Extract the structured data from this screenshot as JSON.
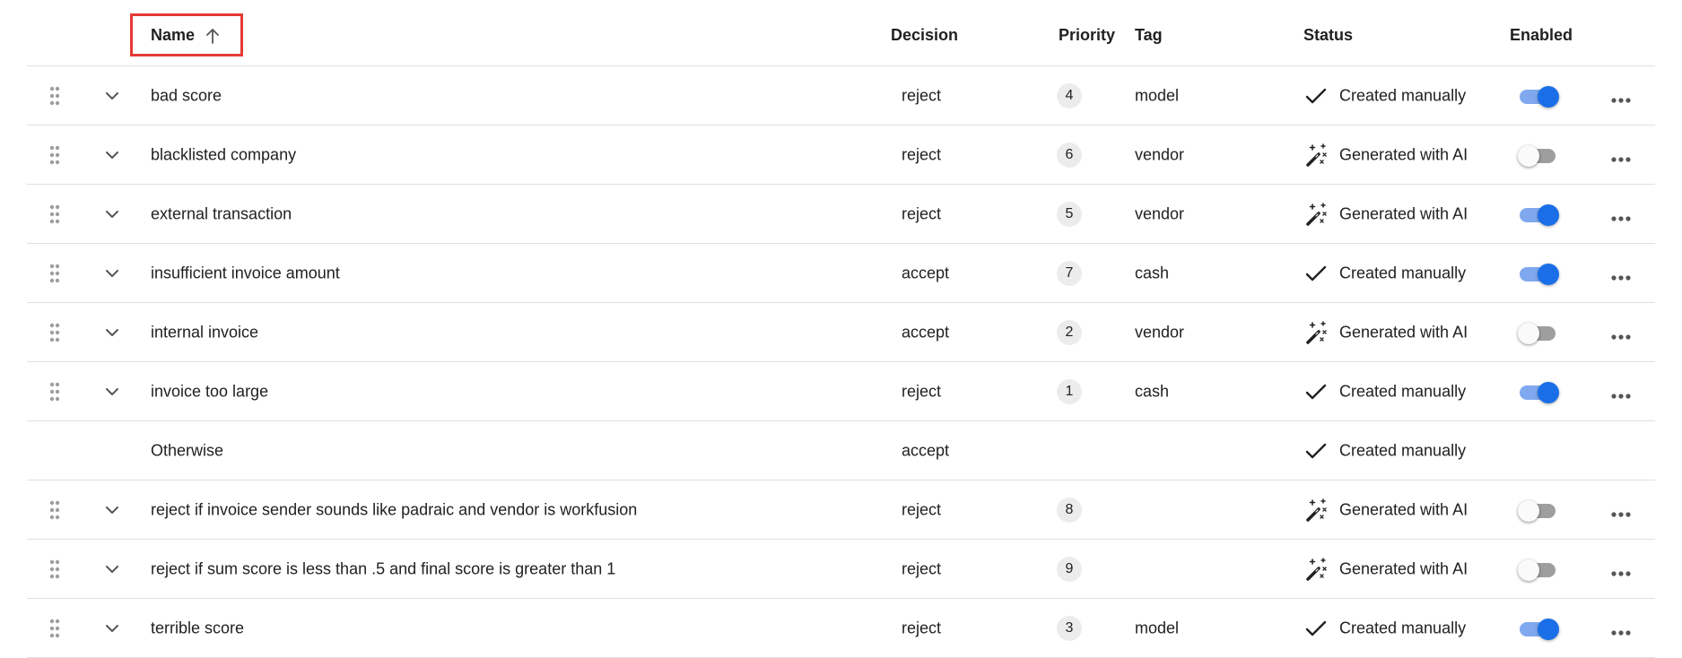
{
  "header": {
    "name": "Name",
    "decision": "Decision",
    "priority": "Priority",
    "tag": "Tag",
    "status": "Status",
    "enabled": "Enabled",
    "sort_icon": "arrow-up-icon"
  },
  "rows": [
    {
      "name": "bad score",
      "decision": "reject",
      "priority": "4",
      "tag": "model",
      "status_icon": "check-icon",
      "status": "Created manually",
      "enabled": true
    },
    {
      "name": "blacklisted company",
      "decision": "reject",
      "priority": "6",
      "tag": "vendor",
      "status_icon": "magic-wand-icon",
      "status": "Generated with AI",
      "enabled": false
    },
    {
      "name": "external transaction",
      "decision": "reject",
      "priority": "5",
      "tag": "vendor",
      "status_icon": "magic-wand-icon",
      "status": "Generated with AI",
      "enabled": true
    },
    {
      "name": "insufficient invoice amount",
      "decision": "accept",
      "priority": "7",
      "tag": "cash",
      "status_icon": "check-icon",
      "status": "Created manually",
      "enabled": true
    },
    {
      "name": "internal invoice",
      "decision": "accept",
      "priority": "2",
      "tag": "vendor",
      "status_icon": "magic-wand-icon",
      "status": "Generated with AI",
      "enabled": false
    },
    {
      "name": "invoice too large",
      "decision": "reject",
      "priority": "1",
      "tag": "cash",
      "status_icon": "check-icon",
      "status": "Created manually",
      "enabled": true
    },
    {
      "name": "Otherwise",
      "decision": "accept",
      "priority": "",
      "tag": "",
      "status_icon": "check-icon",
      "status": "Created manually",
      "enabled": null
    },
    {
      "name": "reject if invoice sender sounds like padraic and vendor is workfusion",
      "decision": "reject",
      "priority": "8",
      "tag": "",
      "status_icon": "magic-wand-icon",
      "status": "Generated with AI",
      "enabled": false
    },
    {
      "name": "reject if sum score is less than .5 and final score is greater than 1",
      "decision": "reject",
      "priority": "9",
      "tag": "",
      "status_icon": "magic-wand-icon",
      "status": "Generated with AI",
      "enabled": false
    },
    {
      "name": "terrible score",
      "decision": "reject",
      "priority": "3",
      "tag": "model",
      "status_icon": "check-icon",
      "status": "Created manually",
      "enabled": true
    }
  ],
  "colors": {
    "accent": "#1a6fe8",
    "accent_track": "#7fa8ef",
    "sort_highlight": "#e53935",
    "divider": "#e0e0e0"
  }
}
